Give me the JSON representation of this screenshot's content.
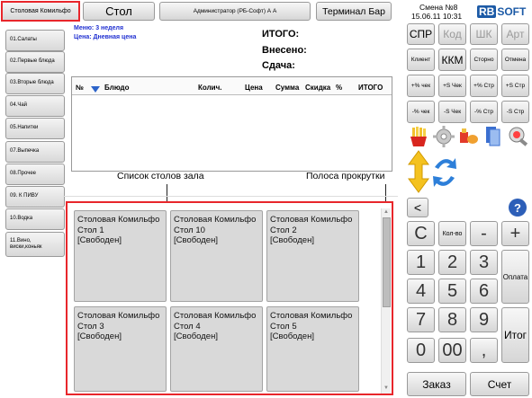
{
  "top": {
    "hall_button": "Столовая Комильфо",
    "table_button": "Стол",
    "admin_button": "Администратор (РБ-Софт) А А",
    "terminal_button": "Терминал Бар",
    "shift_label": "Смена №8",
    "datetime": "15.06.11 10:31",
    "logo_rb": "RB",
    "logo_soft": "SOFT"
  },
  "menu_info": {
    "menu_line": "Меню: 3 неделя",
    "price_line": "Цена: Дневная цена"
  },
  "totals": {
    "total_label": "ИТОГО:",
    "paid_label": "Внесено:",
    "change_label": "Сдача:"
  },
  "order_table": {
    "columns": [
      "№",
      "Блюдо",
      "Колич.",
      "Цена",
      "Сумма",
      "Скидка",
      "%",
      "ИТОГО"
    ]
  },
  "categories": [
    "01.Салаты",
    "02.Первые блюда",
    "03.Вторые блюда",
    "04.Чай",
    "05.Напитки",
    "07.Выпечка",
    "08.Прочее",
    "09. К ПИВУ",
    "10.Водка",
    "11.Вино, виски,коньяк"
  ],
  "annotations": {
    "tables_list": "Список столов зала",
    "scrollbar": "Полоса прокрутки"
  },
  "tables": [
    {
      "hall": "Столовая Комильфо",
      "table": "Стол 1",
      "status": "[Свободен]"
    },
    {
      "hall": "Столовая Комильфо",
      "table": "Стол 10",
      "status": "[Свободен]"
    },
    {
      "hall": "Столовая Комильфо",
      "table": "Стол 2",
      "status": "[Свободен]"
    },
    {
      "hall": "Столовая Комильфо",
      "table": "Стол 3",
      "status": "[Свободен]"
    },
    {
      "hall": "Столовая Комильфо",
      "table": "Стол 4",
      "status": "[Свободен]"
    },
    {
      "hall": "Столовая Комильфо",
      "table": "Стол 5",
      "status": "[Свободен]"
    }
  ],
  "right_panel": {
    "mode_buttons": [
      "СПР",
      "Код",
      "ШК",
      "Арт"
    ],
    "row2": [
      "Клиент",
      "ККМ",
      "Сторно",
      "Отмена"
    ],
    "row3": [
      "+% чек",
      "+S Чек",
      "+% Стр",
      "+S Стр"
    ],
    "row4": [
      "-% чек",
      "-S Чек",
      "-% Стр",
      "-S Стр"
    ],
    "back_label": "<",
    "help_label": "?",
    "keys": {
      "clear": "C",
      "qty": "Кол-во",
      "minus": "-",
      "plus": "+",
      "k1": "1",
      "k2": "2",
      "k3": "3",
      "k4": "4",
      "k5": "5",
      "k6": "6",
      "k7": "7",
      "k8": "8",
      "k9": "9",
      "k0": "0",
      "k00": "00",
      "comma": ",",
      "pay": "Оплата",
      "total": "Итог",
      "order": "Заказ",
      "bill": "Счет"
    }
  },
  "colors": {
    "highlight_red": "#e8262b",
    "menu_blue": "#1f2fd1",
    "logo_blue": "#1c5aa6"
  }
}
